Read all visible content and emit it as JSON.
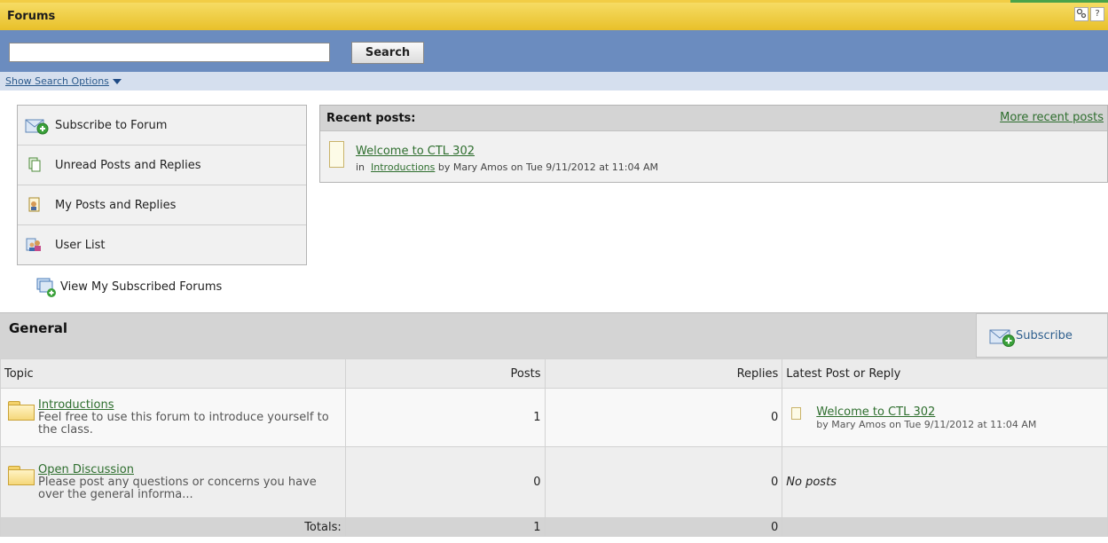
{
  "header": {
    "title": "Forums",
    "icons": [
      "settings-icon",
      "help-icon"
    ],
    "help_glyph": "?"
  },
  "search": {
    "input_value": "",
    "placeholder": "",
    "button_label": "Search",
    "options_link": "Show Search Options"
  },
  "actions": [
    {
      "label": "Subscribe to Forum",
      "icon": "subscribe-icon"
    },
    {
      "label": "Unread Posts and Replies",
      "icon": "unread-posts-icon"
    },
    {
      "label": "My Posts and Replies",
      "icon": "my-posts-icon"
    },
    {
      "label": "User List",
      "icon": "user-list-icon"
    }
  ],
  "view_subscribed": {
    "label": "View My Subscribed Forums",
    "icon": "subscribed-forums-icon"
  },
  "recent_posts": {
    "title": "Recent posts:",
    "more_link": "More recent posts",
    "post": {
      "title": "Welcome to CTL 302",
      "in_label": "in",
      "forum": "Introductions",
      "byline": "by Mary Amos  on Tue 9/11/2012 at 11:04 AM"
    }
  },
  "general": {
    "title": "General",
    "subscribe_label": "Subscribe",
    "columns": {
      "topic": "Topic",
      "posts": "Posts",
      "replies": "Replies",
      "latest": "Latest Post or Reply"
    },
    "rows": [
      {
        "name": "Introductions",
        "description": "Feel free to use this forum to introduce yourself to the class.",
        "posts": "1",
        "replies": "0",
        "latest_title": "Welcome to CTL 302",
        "latest_meta": "by Mary Amos  on Tue 9/11/2012 at 11:04 AM"
      },
      {
        "name": "Open Discussion",
        "description": "Please post any questions or concerns you have over the general informa...",
        "posts": "0",
        "replies": "0",
        "latest_none": "No posts"
      }
    ],
    "totals": {
      "label": "Totals:",
      "posts": "1",
      "replies": "0"
    }
  },
  "colors": {
    "title_bar": "#f0cc45",
    "search_bar": "#6b8cbf",
    "link": "#2e6e2e",
    "panel_header": "#d4d4d4"
  }
}
